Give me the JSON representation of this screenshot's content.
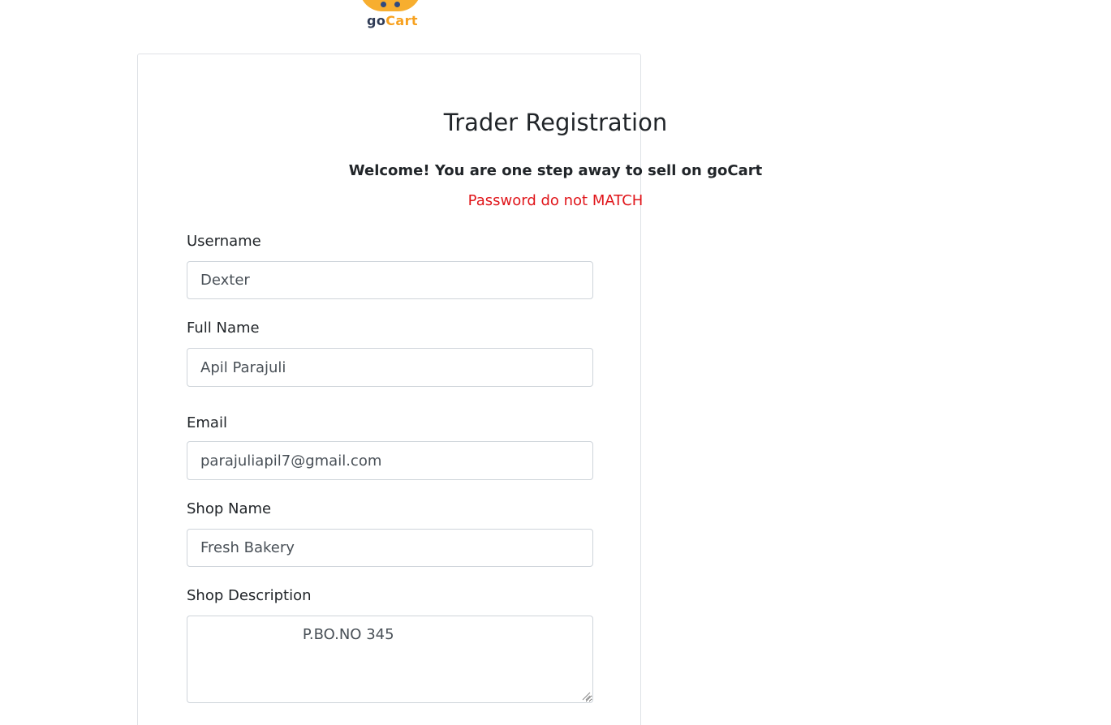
{
  "logo": {
    "brand_go": "go",
    "brand_cart": "Cart",
    "colors": {
      "orange": "#f7ae2f",
      "navy": "#2f3b55"
    }
  },
  "form": {
    "title": "Trader Registration",
    "welcome": "Welcome! You are one step away to sell on goCart",
    "error": "Password do not MATCH",
    "error_color": "#e0151a",
    "fields": {
      "username": {
        "label": "Username",
        "value": "Dexter"
      },
      "full_name": {
        "label": "Full Name",
        "value": "Apil Parajuli"
      },
      "email": {
        "label": "Email",
        "value": "parajuliapil7@gmail.com"
      },
      "shop_name": {
        "label": "Shop Name",
        "value": "Fresh Bakery"
      },
      "shop_description": {
        "label": "Shop Description",
        "value": "                      P.BO.NO 345"
      }
    }
  }
}
